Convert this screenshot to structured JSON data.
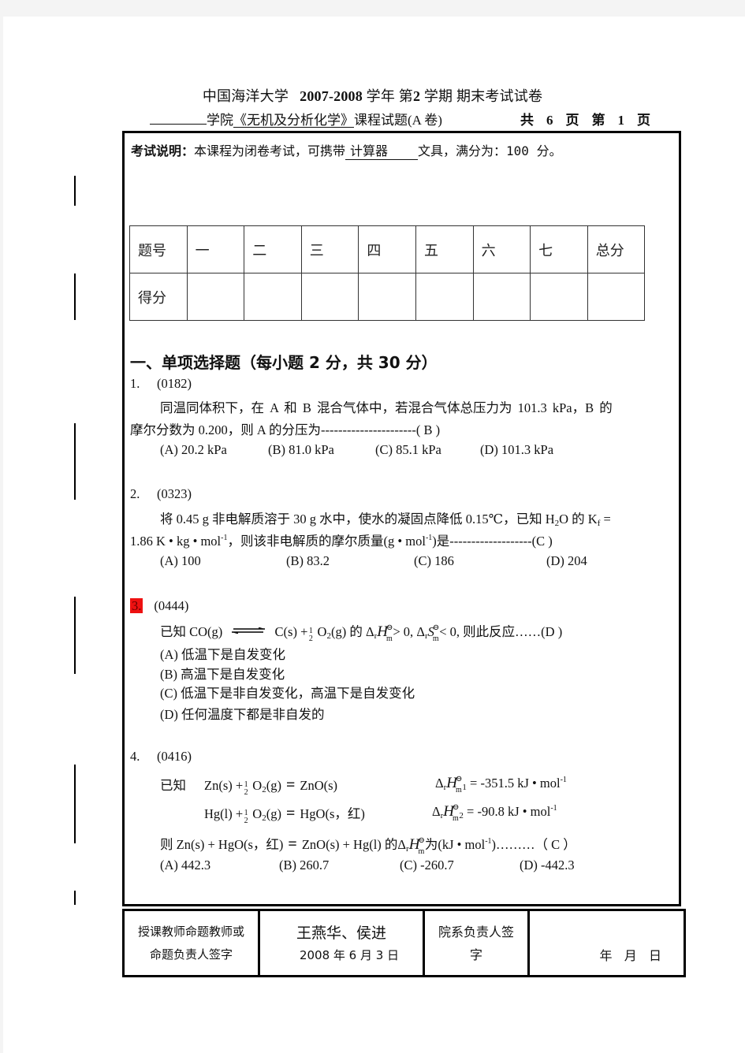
{
  "header": {
    "title_part1": "中国海洋大学",
    "title_years": "2007-2008",
    "title_part2": "学年 第",
    "title_term": "2",
    "title_part3": "学期 期末考试试卷",
    "college_suffix": "学院",
    "course": "《无机及分析化学》",
    "course_suffix": "课程试题(A 卷)",
    "pages_total_label": "共",
    "pages_total": "6",
    "page_label": "页",
    "page_current_label": "第",
    "page_current": "1",
    "page_label2": "页"
  },
  "instructions": {
    "label": "考试说明：",
    "text1": "本课程为闭卷考试，可携带",
    "tool": "计算器",
    "text2": "文具，满分为：100 分。"
  },
  "score_table": {
    "row1": [
      "题号",
      "一",
      "二",
      "三",
      "四",
      "五",
      "六",
      "七",
      "总分"
    ],
    "row2": [
      "得分",
      "",
      "",
      "",
      "",
      "",
      "",
      "",
      ""
    ]
  },
  "section1": {
    "heading": "一、单项选择题（每小题 2 分，共 30 分）"
  },
  "questions": [
    {
      "num": "1.",
      "code": "(0182)",
      "stem_line1": "同温同体积下，在 A 和 B 混合气体中，若混合气体总压力为 101.3 kPa，B 的",
      "stem_line2": "摩尔分数为 0.200，则 A 的分压为----------------------( B )",
      "options": [
        "(A) 20.2 kPa",
        "(B) 81.0 kPa",
        "(C) 85.1 kPa",
        "(D) 101.3 kPa"
      ]
    },
    {
      "num": "2.",
      "code": "(0323)",
      "stem_line1a": "将 0.45 g 非电解质溶于 30 g 水中，使水的凝固点降低 0.15℃，已知 H",
      "stem_line1b": "O 的 K",
      "stem_line1c": " =",
      "stem_line2a": "1.86 K • kg • mol",
      "stem_line2b": "，则该非电解质的摩尔质量(g • mol",
      "stem_line2c": ")是-------------------(C )",
      "sub2": "2",
      "subf": "f",
      "supm1": "-1",
      "options": [
        "(A)  100",
        "(B)  83.2",
        "(C)  186",
        "(D)  204"
      ]
    },
    {
      "num": "3.",
      "code": "(0444)",
      "highlight_color": "#ee1111",
      "stem_pre": "已知  CO(g)",
      "stem_mid": "C(s) +",
      "stem_o2": "O",
      "stem_o2_sub": "2",
      "stem_o2_rest": "(g)  的",
      "cond1": "> 0,",
      "cond2": "< 0,  则此反应……(D  )",
      "options": [
        "(A) 低温下是自发变化",
        "(B) 高温下是自发变化",
        "(C) 低温下是非自发变化，高温下是自发变化",
        "(D) 任何温度下都是非自发的"
      ]
    },
    {
      "num": "4.",
      "code": "(0416)",
      "known": "已知",
      "eq1_left": "Zn(s) +",
      "eq1_right": "ZnO(s)",
      "eq1_dh": "= -351.5  kJ • mol",
      "eq1_idx": "1",
      "eq2_left": "Hg(l) +",
      "eq2_right": "HgO(s，红)",
      "eq2_dh": "= -90.8  kJ • mol",
      "eq2_idx": "2",
      "then_left": "则  Zn(s) + HgO(s，红)",
      "then_right": "ZnO(s) + Hg(l)  的",
      "then_unit": "为(kJ • mol",
      "then_tail": ")………（ C   ）",
      "options": [
        "(A) 442.3",
        "(B) 260.7",
        "(C) -260.7",
        "(D) -442.3"
      ]
    }
  ],
  "footer": {
    "teacher_label_line1": "授课教师命题教师或",
    "teacher_label_line2": "命题负责人签字",
    "teacher_names": "王燕华、侯进",
    "teacher_date": "2008 年 6 月 3 日",
    "dept_label_line1": "院系负责人签",
    "dept_label_line2": "字",
    "dept_date": "年   月   日"
  }
}
